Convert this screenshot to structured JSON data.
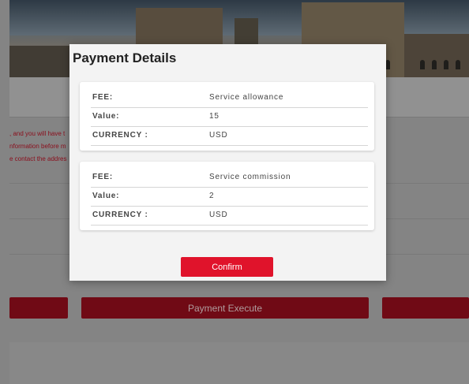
{
  "background": {
    "notice_lines": [
      ", and you will have t",
      "nformation before m",
      "e contact the addres"
    ],
    "execute_button_label": "Payment Execute"
  },
  "modal": {
    "title": "Payment Details",
    "fees": [
      {
        "fee_label": "FEE:",
        "fee_value": "Service allowance",
        "value_label": "Value:",
        "value_value": "15",
        "currency_label": "CURRENCY :",
        "currency_value": "USD"
      },
      {
        "fee_label": "FEE:",
        "fee_value": "Service commission",
        "value_label": "Value:",
        "value_value": "2",
        "currency_label": "CURRENCY :",
        "currency_value": "USD"
      }
    ],
    "confirm_label": "Confirm"
  }
}
